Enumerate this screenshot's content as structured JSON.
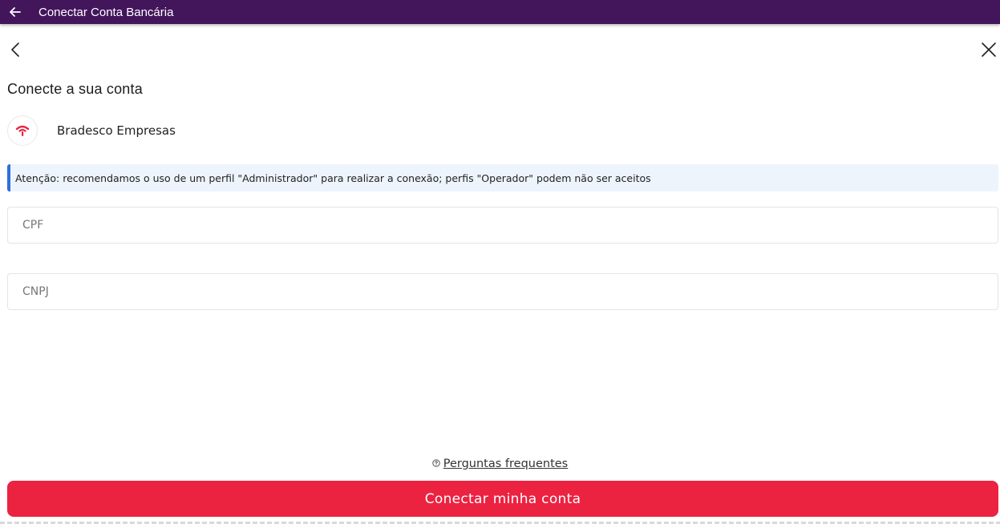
{
  "header": {
    "title": "Conectar Conta Bancária",
    "back_icon": "arrow-left-icon",
    "background": "#43165c"
  },
  "nav": {
    "prev_icon": "chevron-left-icon",
    "close_icon": "close-icon"
  },
  "main": {
    "heading": "Conecte a sua conta",
    "bank": {
      "name": "Bradesco Empresas",
      "logo_icon": "bradesco-logo-icon",
      "logo_color": "#ec2241"
    },
    "alert": {
      "text": "Atenção: recomendamos o uso de um perfil \"Administrador\" para realizar a conexão; perfis \"Operador\" podem não ser aceitos",
      "accent": "#2f6fdc"
    },
    "fields": {
      "cpf": {
        "placeholder": "CPF",
        "value": ""
      },
      "cnpj": {
        "placeholder": "CNPJ",
        "value": ""
      }
    },
    "faq": {
      "label": "Perguntas frequentes",
      "icon": "help-circle-icon"
    },
    "submit": {
      "label": "Conectar minha conta",
      "color": "#ec2241"
    }
  }
}
